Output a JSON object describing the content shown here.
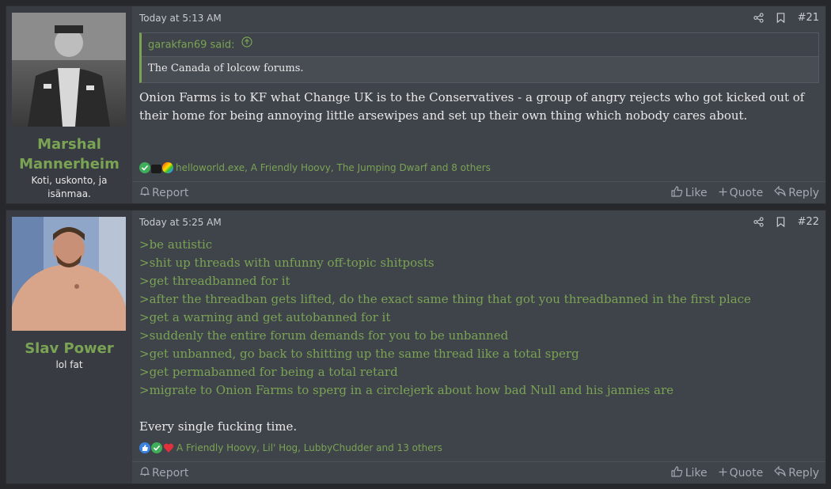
{
  "posts": [
    {
      "user": {
        "name_line1": "Marshal",
        "name_line2": "Mannerheim",
        "title": "Koti, uskonto, ja isänmaa."
      },
      "time": "Today at 5:13 AM",
      "number": "#21",
      "quote": {
        "author": "garakfan69 said:",
        "text": "The Canada of lolcow forums."
      },
      "body": "Onion Farms is to KF what Change UK is to the Conservatives - a group of angry rejects who got kicked out of their home for being annoying little arsewipes and set up their own thing which nobody cares about.",
      "reactions": "helloworld.exe, A Friendly Hoovy, The Jumping Dwarf and 8 others"
    },
    {
      "user": {
        "name": "Slav Power",
        "title": "lol fat"
      },
      "time": "Today at 5:25 AM",
      "number": "#22",
      "greentext": [
        ">be autistic",
        ">shit up threads with unfunny off-topic shitposts",
        ">get threadbanned for it",
        ">after the threadban gets lifted, do the exact same thing that got you threadbanned in the first place",
        ">get a warning and get autobanned for it",
        ">suddenly the entire forum demands for you to be unbanned",
        ">get unbanned, go back to shitting up the same thread like a total sperg",
        ">get permabanned for being a total retard",
        ">migrate to Onion Farms to sperg in a circlejerk about how bad Null and his jannies are"
      ],
      "closing": "Every single fucking time.",
      "reactions": "A Friendly Hoovy, Lil' Hog, LubbyChudder and 13 others"
    }
  ],
  "actions": {
    "report": "Report",
    "like": "Like",
    "quote": "Quote",
    "reply": "Reply"
  },
  "colors": {
    "accent": "#7aa454",
    "panel": "#3f434a",
    "sidebar": "#383c42"
  }
}
